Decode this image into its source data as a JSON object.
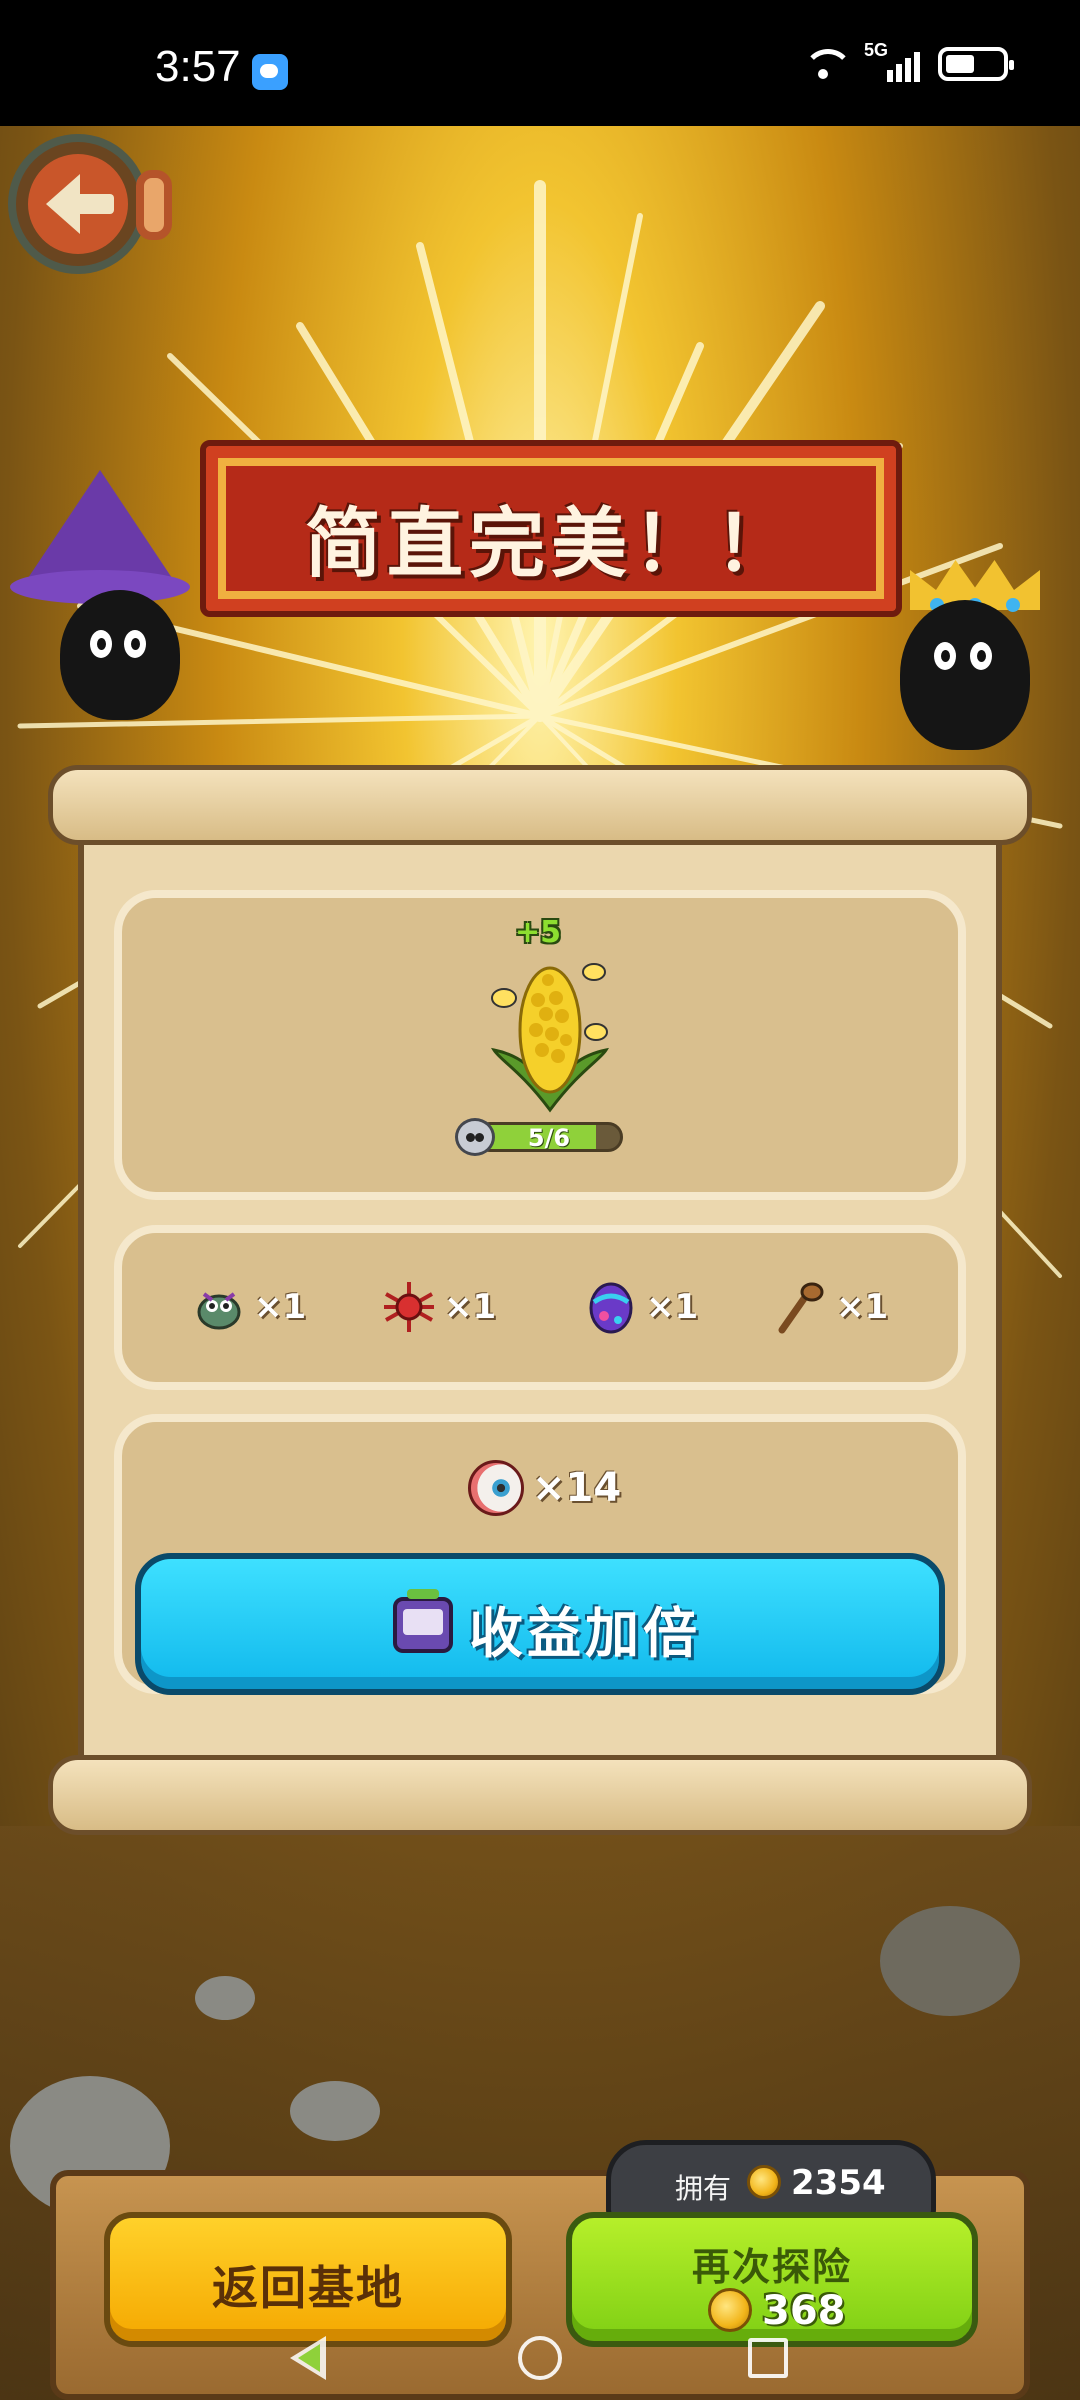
{
  "status_bar": {
    "time": "3:57",
    "network": "5G",
    "icons": [
      "weather-icon",
      "wifi-icon",
      "signal-icon",
      "battery-icon"
    ]
  },
  "game": {
    "banner_title": "简直完美！！",
    "plant": {
      "bonus": "+5",
      "progress_text": "5/6",
      "progress_value": 0.833,
      "icon": "corn-plant-icon"
    },
    "items": [
      {
        "icon": "bug-creature-icon",
        "count": "×1"
      },
      {
        "icon": "spider-icon",
        "count": "×1"
      },
      {
        "icon": "egg-icon",
        "count": "×1"
      },
      {
        "icon": "club-icon",
        "count": "×1"
      }
    ],
    "reward": {
      "icon": "eyeball-icon",
      "count": "×14"
    },
    "double_button_label": "收益加倍"
  },
  "footer": {
    "return_label": "返回基地",
    "own_label": "拥有",
    "own_value": "2354",
    "again_label": "再次探险",
    "again_cost": "368"
  },
  "colors": {
    "banner": "#b52a18",
    "double_button": "#10b8ec",
    "return_button": "#f5a800",
    "again_button": "#7fcf14"
  }
}
